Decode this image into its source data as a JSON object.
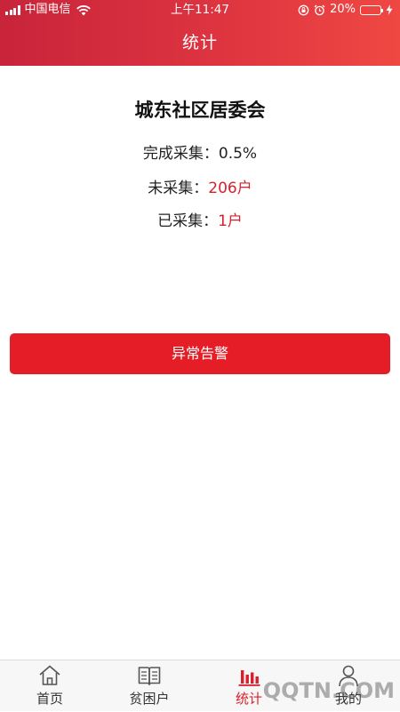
{
  "status_bar": {
    "carrier": "中国电信",
    "time": "上午11:47",
    "battery_text": "20%",
    "battery_level": 0.2
  },
  "header": {
    "title": "统计"
  },
  "summary": {
    "org_name": "城东社区居委会",
    "completion_label": "完成采集：",
    "completion_value": "0.5%",
    "uncollected_label": "未采集：",
    "uncollected_value": "206户",
    "collected_label": "已采集：",
    "collected_value": "1户"
  },
  "alarm_button": {
    "label": "异常告警"
  },
  "tabs": [
    {
      "label": "首页",
      "icon": "home-icon",
      "active": false
    },
    {
      "label": "贫困户",
      "icon": "book-icon",
      "active": false
    },
    {
      "label": "统计",
      "icon": "bar-chart-icon",
      "active": true
    },
    {
      "label": "我的",
      "icon": "user-icon",
      "active": false
    }
  ],
  "watermark": "QQTN.COM",
  "colors": {
    "accent": "#e41d26",
    "header_gradient_start": "#c8243a",
    "header_gradient_end": "#ef4843",
    "highlight_text": "#d8202a"
  }
}
